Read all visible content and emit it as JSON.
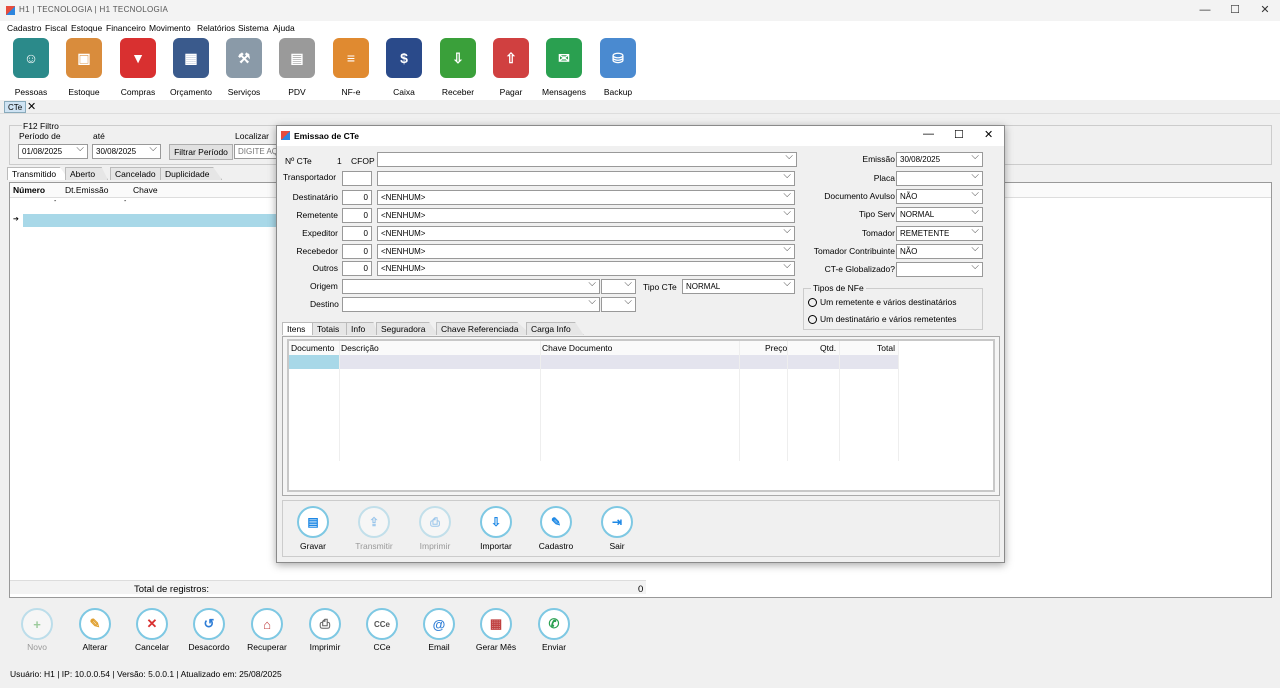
{
  "window": {
    "title": "H1 | TECNOLOGIA | H1 TECNOLOGIA"
  },
  "menu": [
    "Cadastro",
    "Fiscal",
    "Estoque",
    "Financeiro",
    "Movimento",
    "Relatórios",
    "Sistema",
    "Ajuda"
  ],
  "toolbar": [
    {
      "label": "Pessoas",
      "icon": "person-icon",
      "color": "#2b8a8a"
    },
    {
      "label": "Estoque",
      "icon": "box-icon",
      "color": "#d98c3c"
    },
    {
      "label": "Compras",
      "icon": "basket-icon",
      "color": "#d93030"
    },
    {
      "label": "Orçamento",
      "icon": "calculator-icon",
      "color": "#3a5a8c"
    },
    {
      "label": "Serviços",
      "icon": "tools-icon",
      "color": "#8a9aa8"
    },
    {
      "label": "PDV",
      "icon": "cash-register-icon",
      "color": "#9a9a9a"
    },
    {
      "label": "NF-e",
      "icon": "invoice-icon",
      "color": "#e08a30"
    },
    {
      "label": "Caixa",
      "icon": "cash-book-icon",
      "color": "#2a4a8a"
    },
    {
      "label": "Receber",
      "icon": "receive-money-icon",
      "color": "#3aa03a"
    },
    {
      "label": "Pagar",
      "icon": "pay-money-icon",
      "color": "#d04040"
    },
    {
      "label": "Mensagens",
      "icon": "message-icon",
      "color": "#2aa050"
    },
    {
      "label": "Backup",
      "icon": "backup-icon",
      "color": "#4a8ad0"
    }
  ],
  "doc_tab": {
    "label": "CTe"
  },
  "filter": {
    "group_label": "F12 Filtro",
    "period_from_label": "Período de",
    "period_to_label": "até",
    "date_from": "01/08/2025",
    "date_to": "30/08/2025",
    "filter_button": "Filtrar Período",
    "search_label": "Localizar",
    "search_placeholder": "DIGITE AQ"
  },
  "status_tabs": [
    "Transmitido",
    "Aberto",
    "Cancelado",
    "Duplicidade"
  ],
  "main_grid": {
    "columns": [
      "Número",
      "Dt.Emissão",
      "Chave"
    ]
  },
  "totals": {
    "label": "Total de registros:",
    "value": "0"
  },
  "bottom_buttons": [
    {
      "label": "Novo",
      "icon": "plus-icon",
      "enabled": false,
      "color": "#3aa03a"
    },
    {
      "label": "Alterar",
      "icon": "edit-icon",
      "enabled": true,
      "color": "#e0a030"
    },
    {
      "label": "Cancelar",
      "icon": "cancel-icon",
      "enabled": true,
      "color": "#d93030"
    },
    {
      "label": "Desacordo",
      "icon": "undo-icon",
      "enabled": true,
      "color": "#2e7dd6"
    },
    {
      "label": "Recuperar",
      "icon": "recover-icon",
      "enabled": true,
      "color": "#c04040"
    },
    {
      "label": "Imprimir",
      "icon": "printer-icon",
      "enabled": true,
      "color": "#666666"
    },
    {
      "label": "CCe",
      "icon": "cce-icon",
      "enabled": true,
      "color": "#555555"
    },
    {
      "label": "Email",
      "icon": "email-icon",
      "enabled": true,
      "color": "#2e7dd6"
    },
    {
      "label": "Gerar Mês",
      "icon": "calendar-icon",
      "enabled": true,
      "color": "#c04040"
    },
    {
      "label": "Enviar",
      "icon": "whatsapp-icon",
      "enabled": true,
      "color": "#2aa050"
    }
  ],
  "status_bar": "Usuário: H1 | IP: 10.0.0.54 | Versão: 5.0.0.1 | Atualizado em: 25/08/2025",
  "dialog": {
    "title": "Emissao de CTe",
    "num_cte_label": "Nº CTe",
    "num_cte_value": "1",
    "cfop_label": "CFOP",
    "transportador_label": "Transportador",
    "parties": [
      {
        "label": "Destinatário",
        "code": "0",
        "value": "<NENHUM>"
      },
      {
        "label": "Remetente",
        "code": "0",
        "value": "<NENHUM>"
      },
      {
        "label": "Expeditor",
        "code": "0",
        "value": "<NENHUM>"
      },
      {
        "label": "Recebedor",
        "code": "0",
        "value": "<NENHUM>"
      },
      {
        "label": "Outros",
        "code": "0",
        "value": "<NENHUM>"
      }
    ],
    "origem_label": "Origem",
    "destino_label": "Destino",
    "tipo_cte_label": "Tipo CTe",
    "tipo_cte_value": "NORMAL",
    "right_fields": [
      {
        "label": "Emissão",
        "value": "30/08/2025"
      },
      {
        "label": "Placa",
        "value": ""
      },
      {
        "label": "Documento Avulso",
        "value": "NÃO"
      },
      {
        "label": "Tipo Serv",
        "value": "NORMAL"
      },
      {
        "label": "Tomador",
        "value": "REMETENTE"
      },
      {
        "label": "Tomador Contribuinte",
        "value": "NÃO"
      },
      {
        "label": "CT-e Globalizado?",
        "value": ""
      }
    ],
    "nfe_group": {
      "label": "Tipos de NFe",
      "options": [
        "Um remetente e vários destinatários",
        "Um destinatário e vários remetentes"
      ]
    },
    "tabs": [
      "Itens",
      "Totais",
      "Info",
      "Seguradora",
      "Chave Referenciada",
      "Carga Info"
    ],
    "grid_columns": [
      "Documento",
      "Descrição",
      "Chave Documento",
      "Preço",
      "Qtd.",
      "Total"
    ],
    "buttons": [
      {
        "label": "Gravar",
        "icon": "save-icon",
        "enabled": true
      },
      {
        "label": "Transmitir",
        "icon": "transmit-icon",
        "enabled": false
      },
      {
        "label": "Imprimir",
        "icon": "printer-icon",
        "enabled": false
      },
      {
        "label": "Importar",
        "icon": "import-icon",
        "enabled": true
      },
      {
        "label": "Cadastro",
        "icon": "register-icon",
        "enabled": true
      },
      {
        "label": "Sair",
        "icon": "exit-icon",
        "enabled": true
      }
    ]
  }
}
